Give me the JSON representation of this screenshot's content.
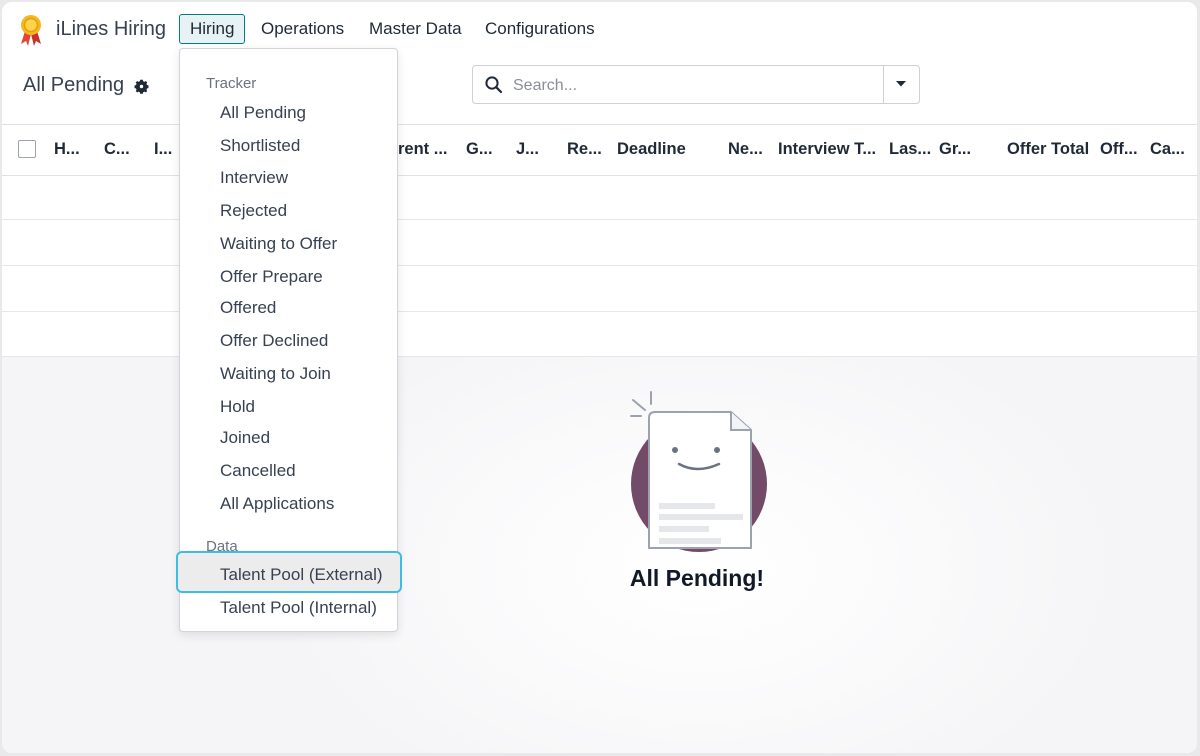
{
  "navbar": {
    "brand": "iLines Hiring",
    "brand_icon": "ribbon-award-icon",
    "menu": [
      "Hiring",
      "Operations",
      "Master Data",
      "Configurations"
    ]
  },
  "control_panel": {
    "title": "All Pending",
    "search_placeholder": "Search..."
  },
  "table": {
    "headers": [
      "H...",
      "C...",
      "I...",
      "rent ...",
      "G...",
      "J...",
      "Re...",
      "Deadline",
      "Ne...",
      "Interview T...",
      "Las...",
      "Gr...",
      "Offer Total",
      "Off...",
      "Ca..."
    ]
  },
  "empty_state": {
    "title": "All Pending!"
  },
  "dropdown": {
    "sections": [
      {
        "header": "Tracker",
        "items": [
          "All Pending",
          "Shortlisted",
          "Interview",
          "Rejected",
          "Waiting to Offer",
          "Offer Prepare",
          "Offered",
          "Offer Declined",
          "Waiting to Join",
          "Hold",
          "Joined",
          "Cancelled",
          "All Applications"
        ]
      },
      {
        "header": "Data",
        "items": [
          "Talent Pool (External)",
          "Talent Pool (Internal)"
        ]
      }
    ],
    "highlighted": "Talent Pool (External)"
  },
  "colors": {
    "accent": "#017e84",
    "focus_ring": "#3fbbe7",
    "illustration_circle": "#714b67"
  }
}
